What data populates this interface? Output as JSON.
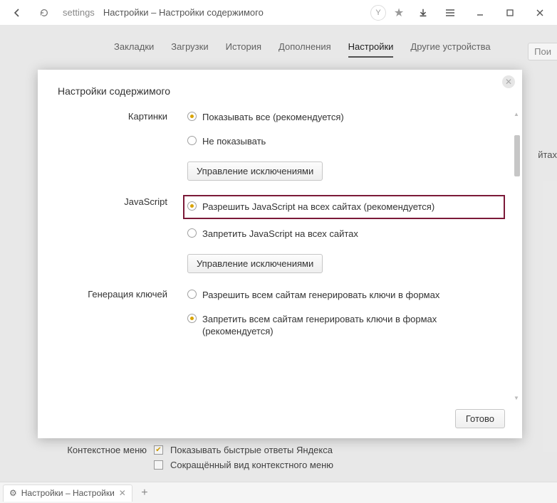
{
  "titlebar": {
    "url_prefix": "settings",
    "page_title": "Настройки – Настройки содержимого"
  },
  "bg_tabs": {
    "items": [
      {
        "label": "Закладки"
      },
      {
        "label": "Загрузки"
      },
      {
        "label": "История"
      },
      {
        "label": "Дополнения"
      },
      {
        "label": "Настройки"
      },
      {
        "label": "Другие устройства"
      }
    ],
    "search_placeholder": "Пои"
  },
  "bg_peek_text": "йтах",
  "modal": {
    "title": "Настройки содержимого",
    "sections": {
      "images": {
        "label": "Картинки",
        "opt_show_all": "Показывать все (рекомендуется)",
        "opt_hide": "Не показывать",
        "manage_btn": "Управление исключениями"
      },
      "javascript": {
        "label": "JavaScript",
        "opt_allow": "Разрешить JavaScript на всех сайтах (рекомендуется)",
        "opt_block": "Запретить JavaScript на всех сайтах",
        "manage_btn": "Управление исключениями"
      },
      "keygen": {
        "label": "Генерация ключей",
        "opt_allow": "Разрешить всем сайтам генерировать ключи в формах",
        "opt_block": "Запретить всем сайтам генерировать ключи в формах (рекомендуется)"
      }
    },
    "done_btn": "Готово"
  },
  "bg_bottom": {
    "label": "Контекстное меню",
    "opt1": "Показывать быстрые ответы Яндекса",
    "opt2": "Сокращённый вид контекстного меню"
  },
  "tabstrip": {
    "tab_title": "Настройки – Настройки"
  }
}
